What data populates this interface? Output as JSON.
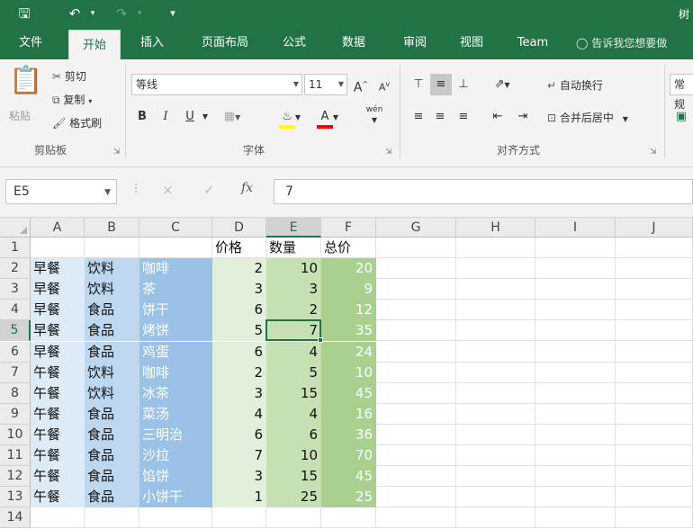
{
  "window": {
    "title_partial": "树"
  },
  "quick_access": {
    "save_icon": "save-icon",
    "undo_icon": "undo-icon",
    "redo_icon": "redo-icon",
    "customize_icon": "customize-icon"
  },
  "tabs": [
    "文件",
    "开始",
    "插入",
    "页面布局",
    "公式",
    "数据",
    "审阅",
    "视图",
    "Team"
  ],
  "active_tab": "开始",
  "tell_me": "告诉我您想要做",
  "clipboard": {
    "paste": "粘贴",
    "cut": "剪切",
    "copy": "复制",
    "format_painter": "格式刷",
    "group": "剪贴板"
  },
  "font": {
    "name": "等线",
    "size": "11",
    "bold": "B",
    "italic": "I",
    "underline": "U",
    "grow": "A",
    "shrink": "A",
    "fill_letter": "A",
    "wen": "wén",
    "group": "字体"
  },
  "alignment": {
    "wrap_text": "自动换行",
    "merge_center": "合并后居中",
    "group": "对齐方式"
  },
  "number": {
    "format_partial": "常规"
  },
  "formula_bar": {
    "name_box": "E5",
    "cancel_icon": "×",
    "enter_icon": "✓",
    "fx": "fx",
    "formula": "7"
  },
  "colors": {
    "brand": "#217346",
    "col_a": "#ddebf7",
    "col_b": "#bdd7ee",
    "col_c": "#9bc2e6",
    "col_d": "#e2efda",
    "col_e": "#c6e0b4",
    "col_f": "#a9d08e"
  },
  "grid": {
    "columns": [
      "A",
      "B",
      "C",
      "D",
      "E",
      "F",
      "G",
      "H",
      "I",
      "J"
    ],
    "rows": [
      "1",
      "2",
      "3",
      "4",
      "5",
      "6",
      "7",
      "8",
      "9",
      "10",
      "11",
      "12",
      "13",
      "14"
    ],
    "header": [
      "",
      "",
      "",
      "价格",
      "数量",
      "总价"
    ],
    "data": [
      [
        "早餐",
        "饮料",
        "咖啡",
        "2",
        "10",
        "20"
      ],
      [
        "早餐",
        "饮料",
        "茶",
        "3",
        "3",
        "9"
      ],
      [
        "早餐",
        "食品",
        "饼干",
        "6",
        "2",
        "12"
      ],
      [
        "早餐",
        "食品",
        "烤饼",
        "5",
        "7",
        "35"
      ],
      [
        "早餐",
        "食品",
        "鸡蛋",
        "6",
        "4",
        "24"
      ],
      [
        "午餐",
        "饮料",
        "咖啡",
        "2",
        "5",
        "10"
      ],
      [
        "午餐",
        "饮料",
        "冰茶",
        "3",
        "15",
        "45"
      ],
      [
        "午餐",
        "食品",
        "菜汤",
        "4",
        "4",
        "16"
      ],
      [
        "午餐",
        "食品",
        "三明治",
        "6",
        "6",
        "36"
      ],
      [
        "午餐",
        "食品",
        "沙拉",
        "7",
        "10",
        "70"
      ],
      [
        "午餐",
        "食品",
        "馅饼",
        "3",
        "15",
        "45"
      ],
      [
        "午餐",
        "食品",
        "小饼干",
        "1",
        "25",
        "25"
      ]
    ],
    "active_cell": "E5"
  }
}
